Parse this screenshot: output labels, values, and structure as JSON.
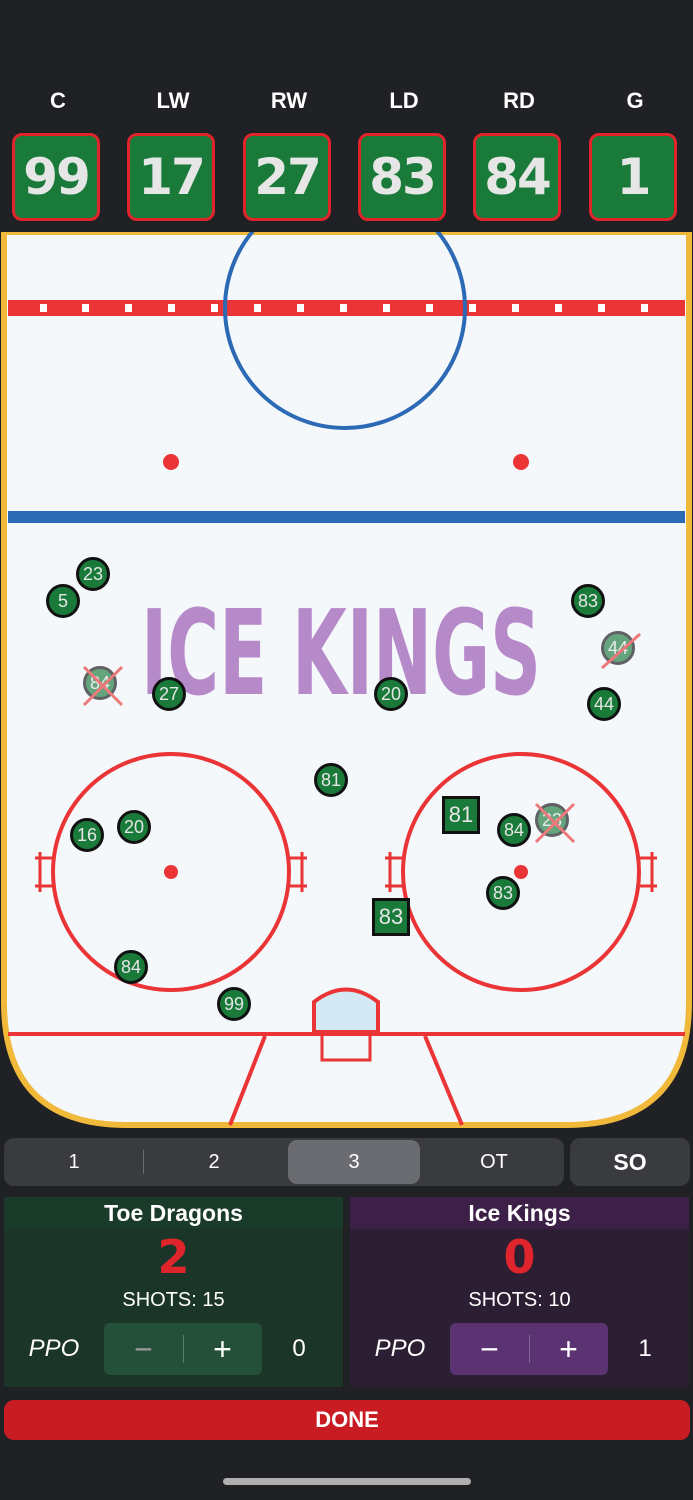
{
  "positions": [
    {
      "label": "C",
      "number": "99"
    },
    {
      "label": "LW",
      "number": "17"
    },
    {
      "label": "RW",
      "number": "27"
    },
    {
      "label": "LD",
      "number": "83"
    },
    {
      "label": "RD",
      "number": "84"
    },
    {
      "label": "G",
      "number": "1"
    }
  ],
  "rink": {
    "logo_text": "ICE  KINGS",
    "markers": [
      {
        "n": "23",
        "style": "circle"
      },
      {
        "n": "5",
        "style": "circle"
      },
      {
        "n": "84",
        "style": "circle-crossed"
      },
      {
        "n": "27",
        "style": "circle"
      },
      {
        "n": "20",
        "style": "circle"
      },
      {
        "n": "83",
        "style": "circle"
      },
      {
        "n": "44",
        "style": "circle-crossed"
      },
      {
        "n": "44",
        "style": "circle"
      },
      {
        "n": "81",
        "style": "circle"
      },
      {
        "n": "20",
        "style": "circle"
      },
      {
        "n": "16",
        "style": "circle"
      },
      {
        "n": "81",
        "style": "square"
      },
      {
        "n": "84",
        "style": "circle"
      },
      {
        "n": "23",
        "style": "circle-crossed"
      },
      {
        "n": "83",
        "style": "circle"
      },
      {
        "n": "83",
        "style": "square"
      },
      {
        "n": "84",
        "style": "circle"
      },
      {
        "n": "99",
        "style": "circle"
      }
    ]
  },
  "periods": {
    "items": [
      "1",
      "2",
      "3",
      "OT"
    ],
    "active": "3",
    "shootout": "SO"
  },
  "teams": [
    {
      "name": "Toe Dragons",
      "score": "2",
      "shots": "SHOTS: 15",
      "ppo_label": "PPO",
      "ppo_value": "0",
      "minus": "−",
      "plus": "+"
    },
    {
      "name": "Ice Kings",
      "score": "0",
      "shots": "SHOTS: 10",
      "ppo_label": "PPO",
      "ppo_value": "1",
      "minus": "−",
      "plus": "+"
    }
  ],
  "done_label": "DONE",
  "colors": {
    "green": "#1a7a3a",
    "red": "#e0242c",
    "purple_logo": "#b68ac8",
    "team1_panel": "#1c3529",
    "team2_panel": "#2c1e33",
    "team1_stepper": "#24503a",
    "team2_stepper": "#5b3272",
    "team1_header": "#1a3a2a",
    "team2_header": "#3c2048"
  }
}
